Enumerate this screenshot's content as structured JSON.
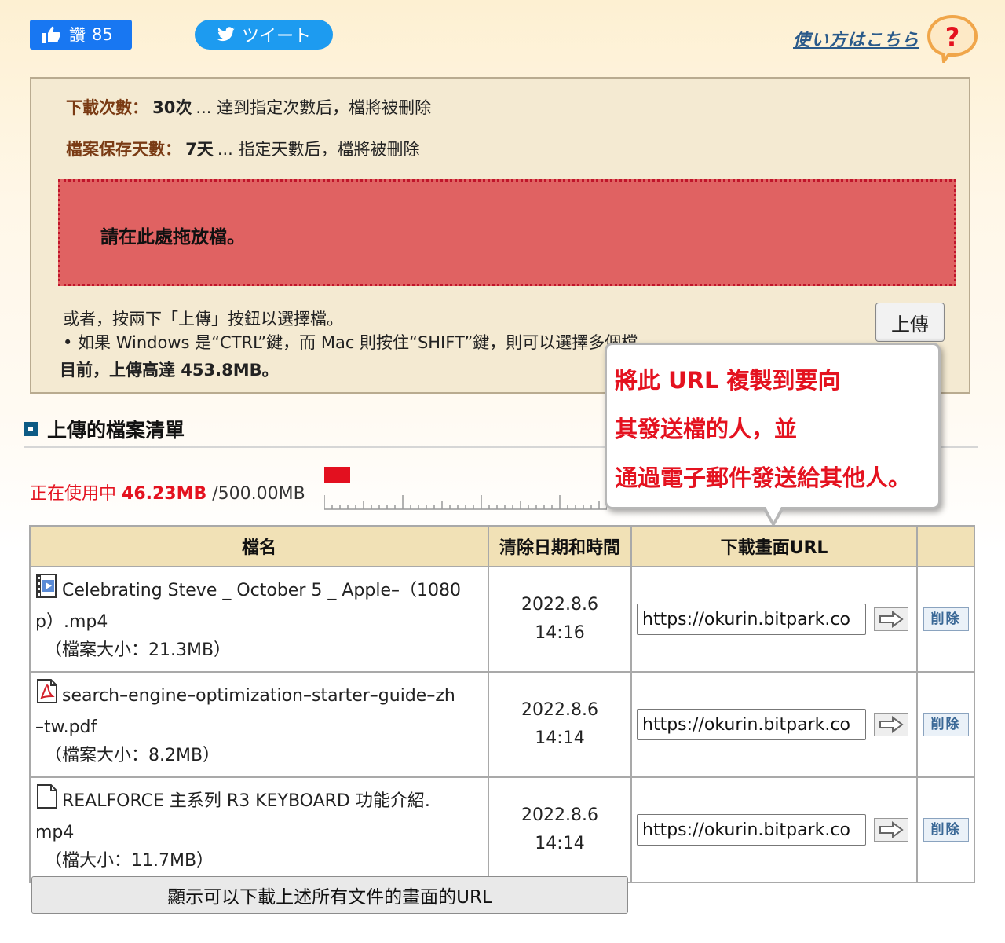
{
  "social": {
    "like_label": "讚",
    "like_count": "85",
    "tweet_label": "ツイート"
  },
  "help": {
    "link_label": "使い方はこちら",
    "icon_glyph": "?"
  },
  "upload_box": {
    "downloads_label": "下載次數：",
    "downloads_value": "30次",
    "downloads_desc": "... 達到指定次數后，檔將被刪除",
    "retention_label": "檔案保存天數：",
    "retention_value": "7天",
    "retention_desc": "... 指定天數后，檔將被刪除",
    "drop_text": "請在此處拖放檔。",
    "alt_text": "或者，按兩下「上傳」按鈕以選擇檔。",
    "multi_text": "• 如果 Windows 是“CTRL”鍵，而 Mac 則按住“SHIFT”鍵，則可以選擇多個檔。",
    "limit_text": "目前，上傳高達 453.8MB。",
    "upload_button": "上傳"
  },
  "tooltip": {
    "line1": "將此 URL 複製到要向",
    "line2": "其發送檔的人，並",
    "line3": "通過電子郵件發送給其他人。"
  },
  "file_list": {
    "title": "上傳的檔案清單",
    "usage_prefix": "正在使用中",
    "usage_used": "46.23MB",
    "usage_total": "/500.00MB",
    "usage_fraction": 0.0925,
    "columns": [
      "檔名",
      "清除日期和時間",
      "下載畫面URL",
      ""
    ],
    "rows": [
      {
        "name_line1": "Celebrating Steve _ October 5 _ Apple–（1080",
        "name_line2": "p）.mp4",
        "size": "（檔案大小：21.3MB）",
        "icon": "video-file-icon",
        "date": "2022.8.6",
        "time": "14:16",
        "url": "https://okurin.bitpark.co",
        "delete_label": "削除"
      },
      {
        "name_line1": "search–engine–optimization–starter–guide–zh",
        "name_line2": "–tw.pdf",
        "size": "（檔案大小：8.2MB）",
        "icon": "pdf-file-icon",
        "date": "2022.8.6",
        "time": "14:14",
        "url": "https://okurin.bitpark.co",
        "delete_label": "削除"
      },
      {
        "name_line1": "REALFORCE 主系列 R3 KEYBOARD 功能介紹.",
        "name_line2": "mp4",
        "size": "（檔大小：11.7MB）",
        "icon": "blank-file-icon",
        "date": "2022.8.6",
        "time": "14:14",
        "url": "https://okurin.bitpark.co",
        "delete_label": "削除"
      }
    ],
    "show_all_button": "顯示可以下載上述所有文件的畫面的URL"
  },
  "colors": {
    "accent_red": "#e4121f",
    "drop_zone": "#e06262",
    "header_bg": "#f1e1b6",
    "label_brown": "#7a3b14"
  }
}
